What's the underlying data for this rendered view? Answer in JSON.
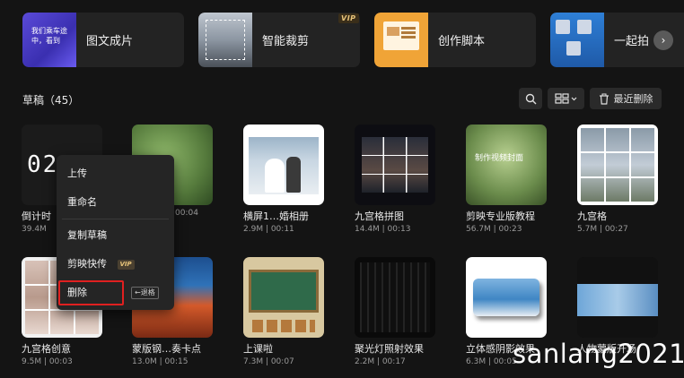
{
  "feature_cards": [
    {
      "label": "图文成片",
      "thumb_text": "我们乘车途中，看到",
      "icon": "text-to-video-thumbnail"
    },
    {
      "label": "智能裁剪",
      "badge": "VIP",
      "icon": "smart-crop-thumbnail"
    },
    {
      "label": "创作脚本",
      "icon": "script-thumbnail"
    },
    {
      "label": "一起拍",
      "icon": "shoot-together-thumbnail"
    }
  ],
  "scroll_icon": "›",
  "drafts": {
    "title": "草稿（45）",
    "recent_delete_label": "最近删除",
    "view_icon": "grid-view-icon",
    "countdown_digits": "02",
    "items": [
      {
        "title": "倒计时",
        "meta": "39.4M"
      },
      {
        "title": "",
        "meta": "00:04",
        "thumb_text": ""
      },
      {
        "title": "横屏1…婚相册",
        "meta": "2.9M | 00:11"
      },
      {
        "title": "九宫格拼图",
        "meta": "14.4M | 00:13"
      },
      {
        "title": "剪映专业版教程",
        "meta": "56.7M | 00:23",
        "thumb_text": "制作视频封面"
      },
      {
        "title": "九宫格",
        "meta": "5.7M | 00:27"
      },
      {
        "title": "九宫格创意",
        "meta": "9.5M | 00:03"
      },
      {
        "title": "蒙版钢…奏卡点",
        "meta": "13.0M | 00:15"
      },
      {
        "title": "上课啦",
        "meta": "7.3M | 00:07"
      },
      {
        "title": "聚光灯照射效果",
        "meta": "2.2M | 00:17"
      },
      {
        "title": "立体感阴影效果",
        "meta": "6.3M | 00:05"
      },
      {
        "title": "人物蒙版开场",
        "meta": ""
      }
    ]
  },
  "context_menu": {
    "upload": "上传",
    "rename": "重命名",
    "duplicate": "复制草稿",
    "quick_share": "剪映快传",
    "quick_share_badge": "VIP",
    "delete": "删除",
    "delete_hotkey": "←退格"
  },
  "watermark": "sanlang2021",
  "colors": {
    "background": "#141414",
    "card": "#232323",
    "delete_highlight": "#e02020",
    "vip_gold": "#e8c47a"
  }
}
